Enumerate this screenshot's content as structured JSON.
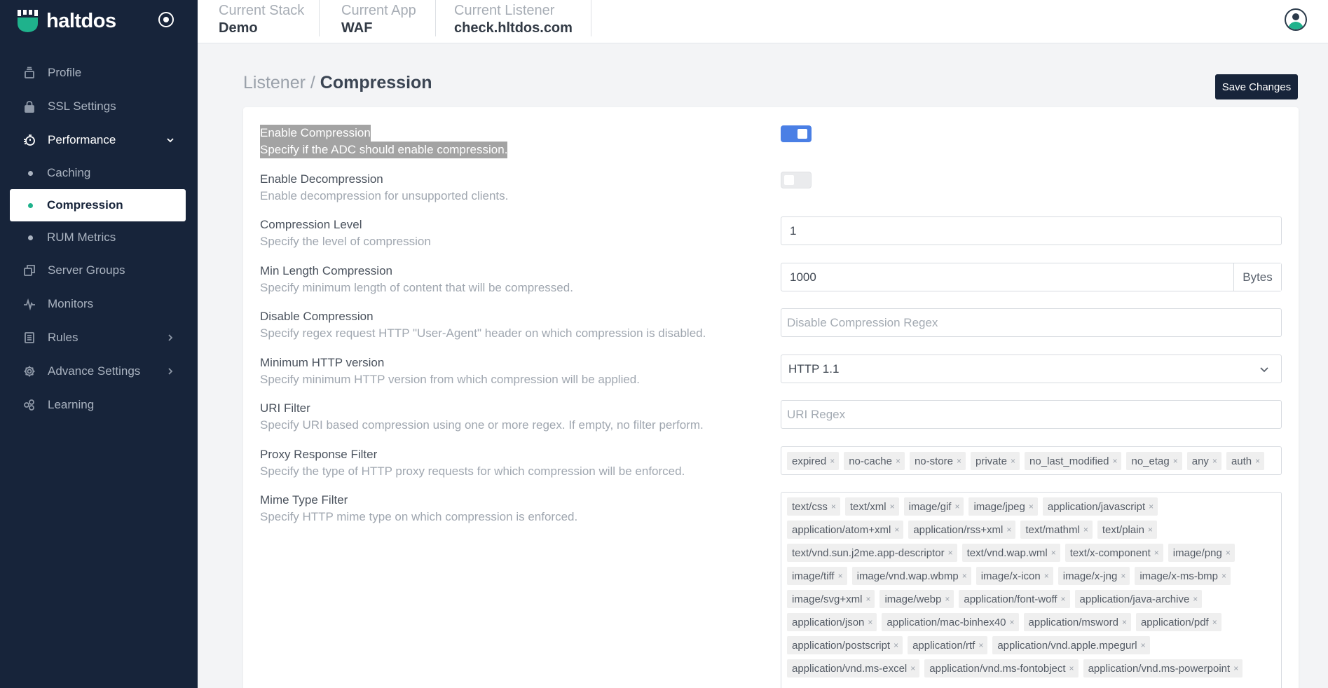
{
  "brand": {
    "name": "haltdos"
  },
  "sidebar": {
    "items": [
      {
        "label": "Profile",
        "icon": "profile-icon"
      },
      {
        "label": "SSL Settings",
        "icon": "lock-icon"
      },
      {
        "label": "Performance",
        "icon": "stopwatch-icon",
        "expanded": true,
        "children": [
          {
            "label": "Caching"
          },
          {
            "label": "Compression",
            "active": true
          },
          {
            "label": "RUM Metrics"
          }
        ]
      },
      {
        "label": "Server Groups",
        "icon": "server-groups-icon"
      },
      {
        "label": "Monitors",
        "icon": "pulse-icon"
      },
      {
        "label": "Rules",
        "icon": "rules-icon",
        "has_children": true
      },
      {
        "label": "Advance Settings",
        "icon": "gear-icon",
        "has_children": true
      },
      {
        "label": "Learning",
        "icon": "learning-icon"
      }
    ]
  },
  "topbar": {
    "stack": {
      "label": "Current Stack",
      "value": "Demo"
    },
    "app": {
      "label": "Current App",
      "value": "WAF"
    },
    "listener": {
      "label": "Current Listener",
      "value": "check.hltdos.com"
    }
  },
  "page": {
    "breadcrumb_parent": "Listener",
    "breadcrumb_separator": " / ",
    "title": "Compression",
    "save_label": "Save Changes"
  },
  "settings": {
    "enable_compression": {
      "title": "Enable Compression",
      "desc": "Specify if the ADC should enable compression.",
      "enabled": true
    },
    "enable_decompression": {
      "title": "Enable Decompression",
      "desc": "Enable decompression for unsupported clients.",
      "enabled": false
    },
    "compression_level": {
      "title": "Compression Level",
      "desc": "Specify the level of compression",
      "value": "1"
    },
    "min_length": {
      "title": "Min Length Compression",
      "desc": "Specify minimum length of content that will be compressed.",
      "value": "1000",
      "unit": "Bytes"
    },
    "disable_compression": {
      "title": "Disable Compression",
      "desc": "Specify regex request HTTP \"User-Agent\" header on which compression is disabled.",
      "placeholder": "Disable Compression Regex"
    },
    "min_http_version": {
      "title": "Minimum HTTP version",
      "desc": "Specify minimum HTTP version from which compression will be applied.",
      "value": "HTTP 1.1"
    },
    "uri_filter": {
      "title": "URI Filter",
      "desc": "Specify URI based compression using one or more regex. If empty, no filter perform.",
      "placeholder": "URI Regex"
    },
    "proxy_response_filter": {
      "title": "Proxy Response Filter",
      "desc": "Specify the type of HTTP proxy requests for which compression will be enforced.",
      "tags": [
        "expired",
        "no-cache",
        "no-store",
        "private",
        "no_last_modified",
        "no_etag",
        "any",
        "auth"
      ]
    },
    "mime_type_filter": {
      "title": "Mime Type Filter",
      "desc": "Specify HTTP mime type on which compression is enforced.",
      "tags": [
        "text/css",
        "text/xml",
        "image/gif",
        "image/jpeg",
        "application/javascript",
        "application/atom+xml",
        "application/rss+xml",
        "text/mathml",
        "text/plain",
        "text/vnd.sun.j2me.app-descriptor",
        "text/vnd.wap.wml",
        "text/x-component",
        "image/png",
        "image/tiff",
        "image/vnd.wap.wbmp",
        "image/x-icon",
        "image/x-jng",
        "image/x-ms-bmp",
        "image/svg+xml",
        "image/webp",
        "application/font-woff",
        "application/java-archive",
        "application/json",
        "application/mac-binhex40",
        "application/msword",
        "application/pdf",
        "application/postscript",
        "application/rtf",
        "application/vnd.apple.mpegurl",
        "application/vnd.ms-excel",
        "application/vnd.ms-fontobject",
        "application/vnd.ms-powerpoint"
      ]
    }
  },
  "colors": {
    "sidebar_bg": "#17243a",
    "accent": "#1fb28c",
    "toggle_on": "#4a7fe5"
  }
}
